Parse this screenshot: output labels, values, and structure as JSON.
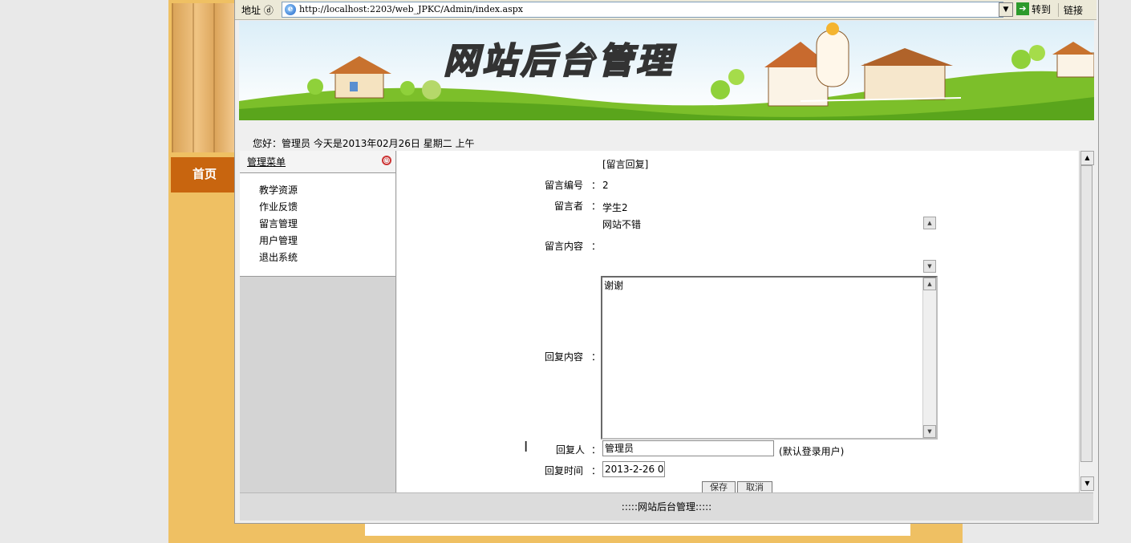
{
  "browser": {
    "address_label": "地址 ⓓ",
    "url": "http://localhost:2203/web_JPKC/Admin/index.aspx",
    "go_label": "转到",
    "links_label": "链接"
  },
  "site": {
    "banner_title": "网站后台管理",
    "home_tab": "首页"
  },
  "greeting": "您好：管理员   今天是2013年02月26日   星期二   上午",
  "menu": {
    "title": "管理菜单",
    "items": [
      "教学资源",
      "作业反馈",
      "留言管理",
      "用户管理",
      "退出系统"
    ]
  },
  "form": {
    "heading": "[留言回复]",
    "id_label": "留言编号",
    "id_value": "2",
    "author_label": "留言者",
    "author_value": "学生2",
    "content_label": "留言内容",
    "content_value": "网站不错",
    "reply_label": "回复内容",
    "reply_value": "谢谢",
    "replier_label": "回复人",
    "replier_value": "管理员",
    "replier_hint": "(默认登录用户)",
    "time_label": "回复时间",
    "time_value": "2013-2-26 0:",
    "save_label": "保存",
    "cancel_label": "取消",
    "colon": "："
  },
  "footer": ":::::网站后台管理:::::"
}
